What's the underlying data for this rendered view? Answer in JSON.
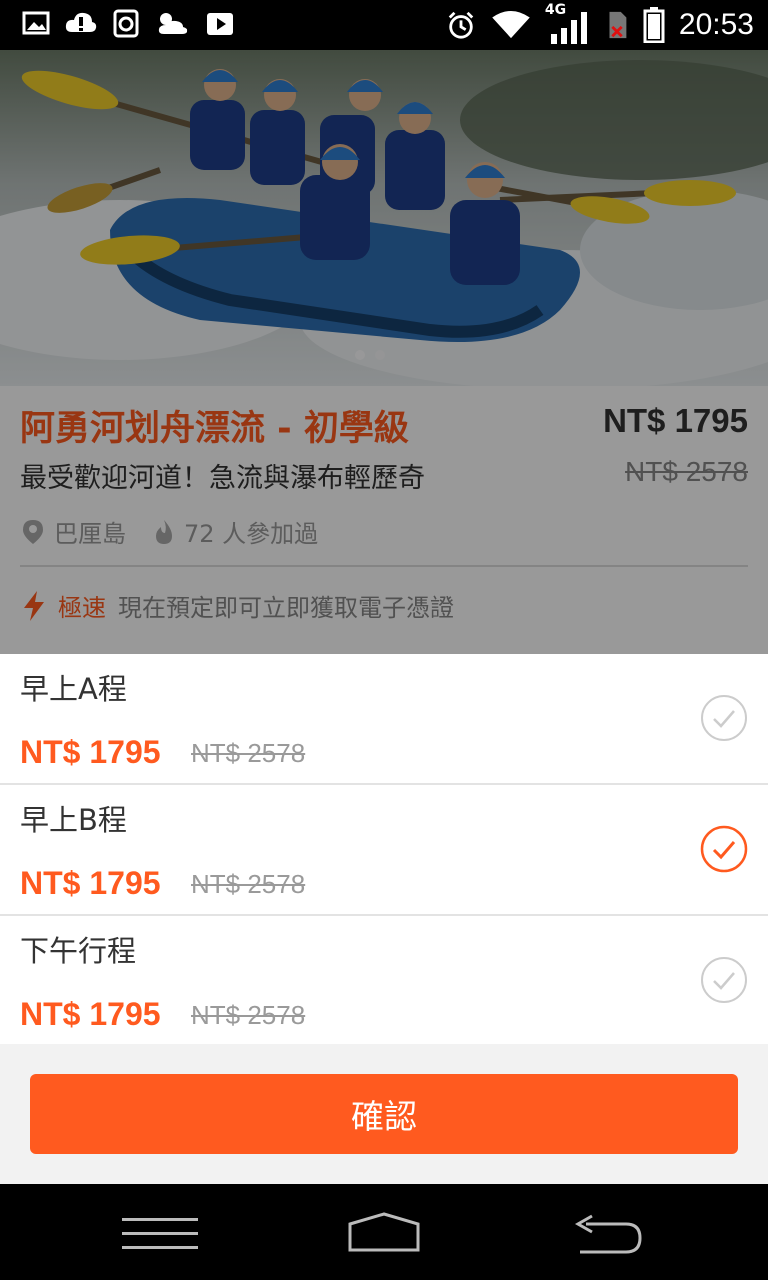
{
  "status_bar": {
    "time": "20:53",
    "network": "4G",
    "left_icons": [
      "gallery-icon",
      "cloud-icon",
      "recycle-icon",
      "weather-icon",
      "play-store-icon"
    ],
    "right_icons": [
      "alarm-icon",
      "wifi-icon",
      "cell-signal-icon",
      "sim-error-icon",
      "battery-icon"
    ]
  },
  "product": {
    "title": "阿勇河划舟漂流 - 初學級",
    "subtitle": "最受歡迎河道！急流與瀑布輕歷奇",
    "price": "NT$ 1795",
    "original_price": "NT$ 2578",
    "location": "巴厘島",
    "participants": "72 人參加過",
    "instant_tag": "極速",
    "instant_text": "現在預定即可立即獲取電子憑證"
  },
  "options": [
    {
      "name": "早上A程",
      "price": "NT$ 1795",
      "original_price": "NT$ 2578",
      "selected": false
    },
    {
      "name": "早上B程",
      "price": "NT$ 1795",
      "original_price": "NT$ 2578",
      "selected": true
    },
    {
      "name": "下午行程",
      "price": "NT$ 1795",
      "original_price": "NT$ 2578",
      "selected": false
    }
  ],
  "confirm_label": "確認",
  "colors": {
    "accent": "#ff5a1f",
    "check_inactive": "#cccccc"
  },
  "nav": [
    "menu-icon",
    "home-icon",
    "back-icon"
  ]
}
